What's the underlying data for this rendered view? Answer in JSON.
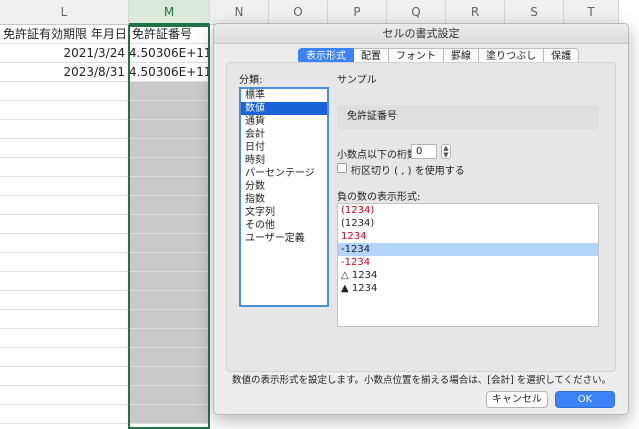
{
  "columns": [
    "L",
    "M",
    "N",
    "O",
    "P",
    "Q",
    "R",
    "S",
    "T"
  ],
  "sheet": {
    "header_row": {
      "col_l": "免許証有効期限 年月日",
      "col_m": "免許証番号"
    },
    "rows": [
      {
        "col_l": "2021/3/24",
        "col_m": "4.50306E+11"
      },
      {
        "col_l": "2023/8/31",
        "col_m": "4.50306E+11"
      }
    ]
  },
  "dialog": {
    "title": "セルの書式設定",
    "tabs": [
      "表示形式",
      "配置",
      "フォント",
      "罫線",
      "塗りつぶし",
      "保護"
    ],
    "active_tab": "表示形式",
    "category_label": "分類:",
    "categories": [
      "標準",
      "数値",
      "通貨",
      "会計",
      "日付",
      "時刻",
      "パーセンテージ",
      "分数",
      "指数",
      "文字列",
      "その他",
      "ユーザー定義"
    ],
    "selected_category": "数値",
    "sample_label": "サンプル",
    "sample_value": "免許証番号",
    "decimal_label": "小数点以下の桁数:",
    "decimal_value": "0",
    "separator_label": "桁区切り ( , ) を使用する",
    "negative_label": "負の数の表示形式:",
    "negative_formats": [
      {
        "text": "(1234)",
        "color": "#d0021b"
      },
      {
        "text": "(1234)",
        "color": "#222222"
      },
      {
        "text": "1234",
        "color": "#d0021b"
      },
      {
        "text": "-1234",
        "color": "#222222"
      },
      {
        "text": "-1234",
        "color": "#d0021b"
      },
      {
        "text": "△ 1234",
        "color": "#222222"
      },
      {
        "text": "▲ 1234",
        "color": "#222222"
      }
    ],
    "selected_negative_index": 3,
    "description": "数値の表示形式を設定します。小数点位置を揃える場合は、[会計] を選択してください。",
    "cancel_label": "キャンセル",
    "ok_label": "OK"
  },
  "colors": {
    "accent": "#3b82f6",
    "selection_green": "#217346",
    "selected_column": "#c9c9c9"
  }
}
